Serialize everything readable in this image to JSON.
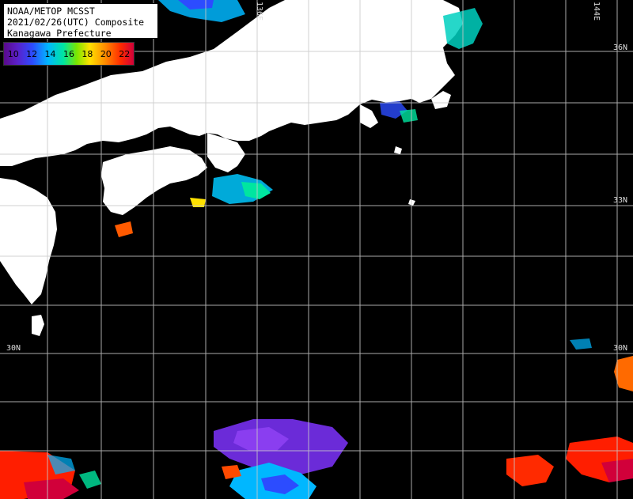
{
  "header": {
    "line1": "NOAA/METOP MCSST",
    "line2": "2021/02/26(UTC) Composite",
    "line3": "Kanagawa Prefecture"
  },
  "legend": {
    "labels": [
      "10",
      "12",
      "14",
      "16",
      "18",
      "20",
      "22"
    ],
    "colors": [
      "#5a0a8a",
      "#2c4cff",
      "#00b7ff",
      "#00e6a0",
      "#ffe200",
      "#ff8c00",
      "#ff2a00",
      "#d1003a"
    ]
  },
  "grid_labels": {
    "lon_136": "136E",
    "lon_144": "144E",
    "lat_36": "36N",
    "lat_33": "33N",
    "lat_30_left": "30N",
    "lat_30_right": "30N"
  },
  "colors": {
    "background": "#000000",
    "land": "#ffffff",
    "grid": "#c8c8c8"
  }
}
